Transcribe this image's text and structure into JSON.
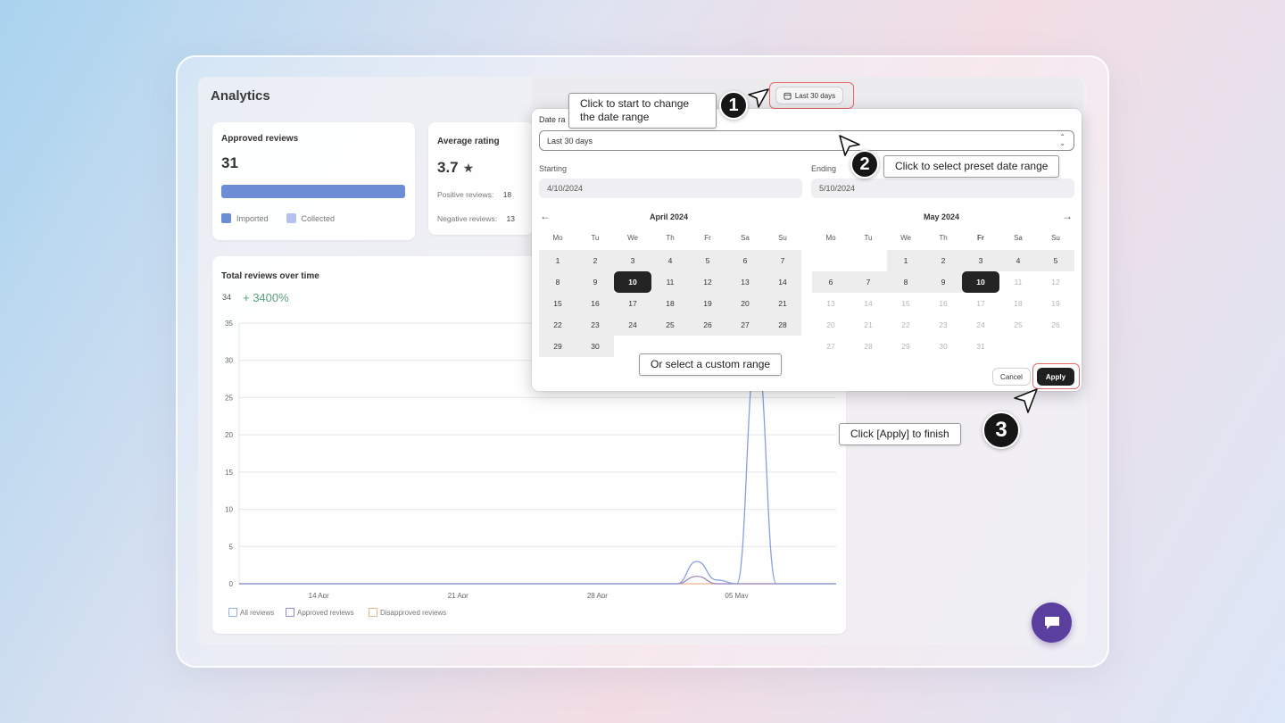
{
  "page": {
    "title": "Analytics"
  },
  "approved_card": {
    "title": "Approved reviews",
    "value": "31",
    "legend_imported": "Imported",
    "legend_collected": "Collected",
    "imported_fraction": 1.0,
    "colors": {
      "imported": "#6d8cd6",
      "collected": "#b4c2ef"
    }
  },
  "rating_card": {
    "title": "Average rating",
    "value": "3.7",
    "star_icon": "star-icon",
    "positive_label": "Positive reviews:",
    "positive_value": "18",
    "negative_label": "Negative reviews:",
    "negative_value": "13"
  },
  "chart_card": {
    "title": "Total reviews over time",
    "total": "34",
    "change": "+ 3400%",
    "legend": [
      "All reviews",
      "Approved reviews",
      "Disapproved reviews"
    ]
  },
  "chart_data": {
    "type": "line",
    "title": "Total reviews over time",
    "xlabel": "",
    "ylabel": "",
    "x_ticks": [
      "14 Apr",
      "21 Apr",
      "28 Apr",
      "05 May"
    ],
    "y_ticks": [
      0,
      5,
      10,
      15,
      20,
      25,
      30,
      35
    ],
    "ylim": [
      0,
      35
    ],
    "x_range": [
      "2024-04-10",
      "2024-05-10"
    ],
    "series": [
      {
        "name": "All reviews",
        "color": "#8a9fdc",
        "points": [
          [
            "2024-04-10",
            0
          ],
          [
            "2024-05-02",
            0
          ],
          [
            "2024-05-03",
            3
          ],
          [
            "2024-05-04",
            0.5
          ],
          [
            "2024-05-05",
            0
          ],
          [
            "2024-05-06",
            31
          ],
          [
            "2024-05-07",
            0
          ],
          [
            "2024-05-10",
            0
          ]
        ]
      },
      {
        "name": "Approved reviews",
        "color": "#9a86c8",
        "points": [
          [
            "2024-04-10",
            0
          ],
          [
            "2024-05-02",
            0
          ],
          [
            "2024-05-03",
            1
          ],
          [
            "2024-05-04",
            0
          ],
          [
            "2024-05-10",
            0
          ]
        ]
      },
      {
        "name": "Disapproved reviews",
        "color": "#e8b48a",
        "points": [
          [
            "2024-04-10",
            0
          ],
          [
            "2024-05-10",
            0
          ]
        ]
      }
    ],
    "grid": true
  },
  "date_picker": {
    "trigger_label": "Last 30 days",
    "trigger_icon": "calendar-icon",
    "date_range_label": "Date ra",
    "preset_value": "Last 30 days",
    "starting_label": "Starting",
    "starting_value": "4/10/2024",
    "ending_label": "Ending",
    "ending_value": "5/10/2024",
    "april": {
      "title": "April 2024"
    },
    "may": {
      "title": "May 2024"
    },
    "weekdays": [
      "Mo",
      "Tu",
      "We",
      "Th",
      "Fr",
      "Sa",
      "Su"
    ],
    "cancel_label": "Cancel",
    "apply_label": "Apply"
  },
  "callouts": {
    "step1": "Click to start to change the date range",
    "step2": "Click to select preset date range",
    "custom": "Or select a custom range",
    "step3": "Click [Apply] to  finish"
  },
  "steps": [
    "1",
    "2",
    "3"
  ]
}
